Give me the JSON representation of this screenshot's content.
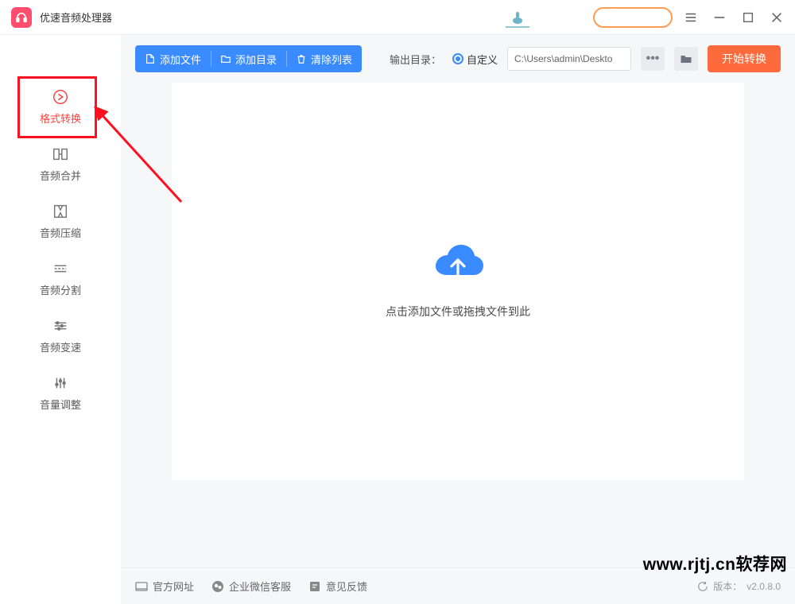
{
  "app": {
    "title": "优速音频处理器"
  },
  "sidebar": {
    "items": [
      {
        "label": "格式转换"
      },
      {
        "label": "音频合并"
      },
      {
        "label": "音频压缩"
      },
      {
        "label": "音频分割"
      },
      {
        "label": "音频变速"
      },
      {
        "label": "音量调整"
      }
    ]
  },
  "toolbar": {
    "add_file": "添加文件",
    "add_folder": "添加目录",
    "clear_list": "清除列表",
    "output_label": "输出目录：",
    "output_option": "自定义",
    "output_path": "C:\\Users\\admin\\Deskto",
    "start": "开始转换"
  },
  "canvas": {
    "drop_text": "点击添加文件或拖拽文件到此"
  },
  "footer": {
    "site": "官方网址",
    "wechat": "企业微信客服",
    "feedback": "意见反馈",
    "version_label": "版本：",
    "version": "v2.0.8.0"
  },
  "watermark": "www.rjtj.cn软荐网"
}
